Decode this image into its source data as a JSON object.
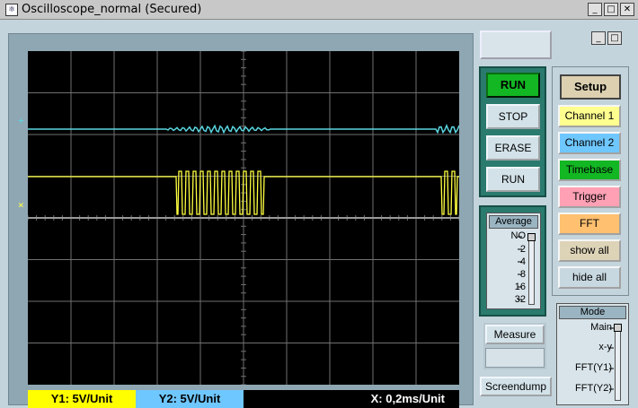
{
  "window": {
    "title": "Oscilloscope_normal (Secured)",
    "minimize_label": "_",
    "maximize_label": "□",
    "close_label": "✕"
  },
  "scope": {
    "ch1_marker": "+",
    "ch2_marker": "×",
    "colors": {
      "ch1": "#5ad6e0",
      "ch2": "#ffff40",
      "grid": "#707070",
      "ground": "#9a9a9a"
    }
  },
  "status": {
    "y1": "Y1: 5V/Unit",
    "y2": "Y2: 5V/Unit",
    "x": "X: 0,2ms/Unit"
  },
  "small_window_buttons": {
    "minimize": "_",
    "maximize": "□"
  },
  "run_panel": {
    "run_top": "RUN",
    "stop": "STOP",
    "erase": "ERASE",
    "run_bottom": "RUN"
  },
  "average": {
    "title": "Average",
    "options": [
      "NO",
      "2",
      "4",
      "8",
      "16",
      "32"
    ],
    "selected": "NO"
  },
  "measure": {
    "button": "Measure"
  },
  "screendump": "Screendump",
  "setup": {
    "title": "Setup",
    "buttons": [
      {
        "label": "Channel 1",
        "color": "#ffff90"
      },
      {
        "label": "Channel 2",
        "color": "#6fc7ff"
      },
      {
        "label": "Timebase",
        "color": "#13b623"
      },
      {
        "label": "Trigger",
        "color": "#ffa0b4"
      },
      {
        "label": "FFT",
        "color": "#ffc070"
      },
      {
        "label": "show all",
        "color": "#ddd4b8"
      },
      {
        "label": "hide all",
        "color": "#c8d8e0"
      }
    ]
  },
  "mode": {
    "title": "Mode",
    "options": [
      "Main",
      "x-y",
      "FFT(Y1)",
      "FFT(Y2)"
    ],
    "selected": "Main"
  }
}
